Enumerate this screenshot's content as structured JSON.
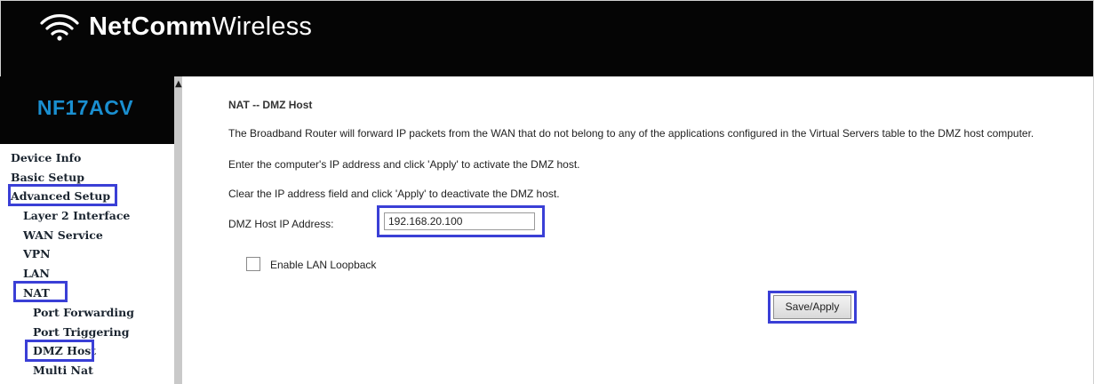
{
  "header": {
    "logo_icon": "wifi-icon",
    "brand_bold": "NetComm",
    "brand_light": "Wireless"
  },
  "model": "NF17ACV",
  "sidebar": {
    "items": [
      {
        "label": "Device Info",
        "level": 0
      },
      {
        "label": "Basic Setup",
        "level": 0
      },
      {
        "label": "Advanced Setup",
        "level": 0,
        "highlighted": true
      },
      {
        "label": "Layer 2 Interface",
        "level": 1
      },
      {
        "label": "WAN Service",
        "level": 1
      },
      {
        "label": "VPN",
        "level": 1
      },
      {
        "label": "LAN",
        "level": 1
      },
      {
        "label": "NAT",
        "level": 1,
        "highlighted": true
      },
      {
        "label": "Port Forwarding",
        "level": 2
      },
      {
        "label": "Port Triggering",
        "level": 2
      },
      {
        "label": "DMZ Host",
        "level": 2,
        "highlighted": true
      },
      {
        "label": "Multi Nat",
        "level": 2
      }
    ]
  },
  "main": {
    "title": "NAT -- DMZ Host",
    "description": "The Broadband Router will forward IP packets from the WAN that do not belong to any of the applications configured in the Virtual Servers table to the DMZ host computer.",
    "instruction_apply": "Enter the computer's IP address and click 'Apply' to activate the DMZ host.",
    "instruction_clear": "Clear the IP address field and click 'Apply' to deactivate the DMZ host.",
    "ip_label": "DMZ Host IP Address:",
    "ip_value": "192.168.20.100",
    "loopback_label": "Enable LAN Loopback",
    "loopback_checked": false,
    "save_label": "Save/Apply"
  },
  "colors": {
    "highlight": "#3a3fd6",
    "model_text": "#1a8fd0",
    "header_bg": "#050505"
  }
}
